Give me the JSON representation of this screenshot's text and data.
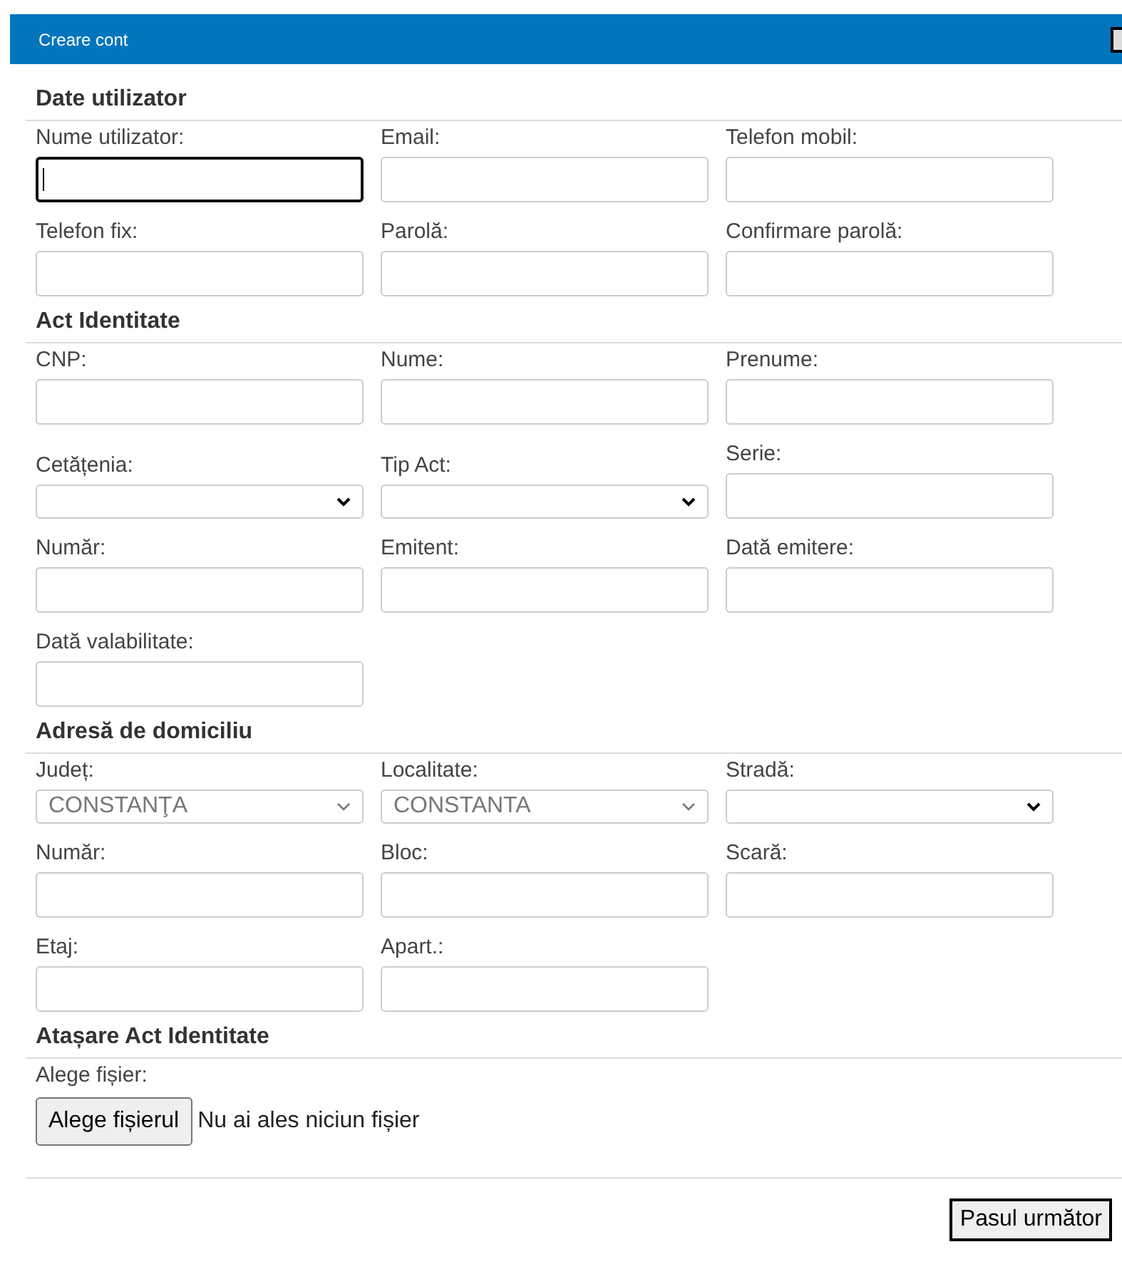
{
  "window": {
    "title": "Creare cont"
  },
  "sections": [
    {
      "title": "Date utilizator",
      "fields": [
        {
          "label": "Nume utilizator:",
          "kind": "text",
          "focused": true
        },
        {
          "label": "Email:",
          "kind": "text",
          "focused": false
        },
        {
          "label": "Telefon mobil:",
          "kind": "text",
          "focused": false
        },
        {
          "label": "Telefon fix:",
          "kind": "text",
          "focused": false
        },
        {
          "label": "Parolă:",
          "kind": "text",
          "focused": false
        },
        {
          "label": "Confirmare parolă:",
          "kind": "text",
          "focused": false
        }
      ]
    },
    {
      "title": "Act Identitate",
      "fields": [
        {
          "label": "CNP:",
          "kind": "text",
          "focused": false
        },
        {
          "label": "Nume:",
          "kind": "text",
          "focused": false
        },
        {
          "label": "Prenume:",
          "kind": "text",
          "focused": false
        },
        {
          "label": "Cetățenia:",
          "kind": "select",
          "disabled": false
        },
        {
          "label": "Tip Act:",
          "kind": "select",
          "disabled": false
        },
        {
          "label": "Serie:",
          "kind": "text",
          "focused": false
        },
        {
          "label": "Număr:",
          "kind": "text",
          "focused": false
        },
        {
          "label": "Emitent:",
          "kind": "text",
          "focused": false
        },
        {
          "label": "Dată emitere:",
          "kind": "text",
          "focused": false
        },
        {
          "label": "Dată valabilitate:",
          "kind": "text",
          "focused": false
        }
      ]
    },
    {
      "title": "Adresă de domiciliu",
      "fields": [
        {
          "label": "Județ:",
          "kind": "select",
          "value": "CONSTANŢA",
          "disabled": true
        },
        {
          "label": "Localitate:",
          "kind": "select",
          "value": "CONSTANTA",
          "disabled": true
        },
        {
          "label": "Stradă:",
          "kind": "select",
          "disabled": false
        },
        {
          "label": "Număr:",
          "kind": "text",
          "focused": false
        },
        {
          "label": "Bloc:",
          "kind": "text",
          "focused": false
        },
        {
          "label": "Scară:",
          "kind": "text",
          "focused": false
        },
        {
          "label": "Etaj:",
          "kind": "text",
          "focused": false
        },
        {
          "label": "Apart.:",
          "kind": "text",
          "focused": false
        }
      ]
    },
    {
      "title": "Atașare Act Identitate",
      "fields": [
        {
          "label": "Alege fișier:",
          "kind": "file",
          "button": "Alege fișierul",
          "status": "Nu ai ales niciun fișier"
        }
      ]
    }
  ],
  "next_button": "Pasul următor"
}
